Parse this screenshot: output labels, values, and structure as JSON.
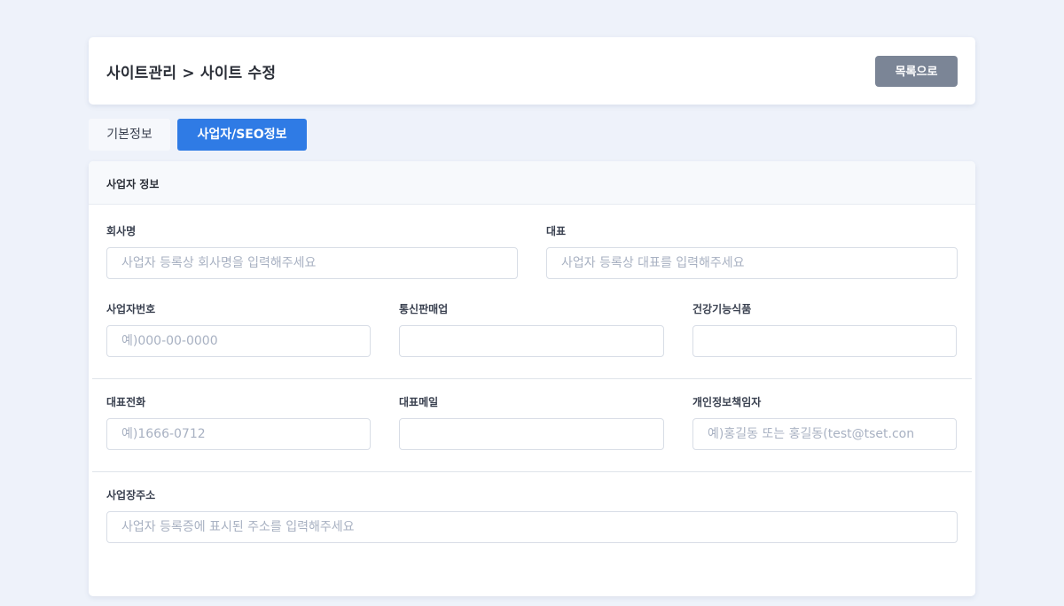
{
  "header": {
    "title": "사이트관리 > 사이트 수정",
    "back_button": "목록으로"
  },
  "tabs": [
    {
      "label": "기본정보",
      "active": false
    },
    {
      "label": "사업자/SEO정보",
      "active": true
    }
  ],
  "section": {
    "title": "사업자 정보"
  },
  "fields": {
    "company_name": {
      "label": "회사명",
      "value": "",
      "placeholder": "사업자 등록상 회사명을 입력해주세요"
    },
    "ceo": {
      "label": "대표",
      "value": "",
      "placeholder": "사업자 등록상 대표를 입력해주세요"
    },
    "business_number": {
      "label": "사업자번호",
      "value": "",
      "placeholder": "예)000-00-0000"
    },
    "mail_order_number": {
      "label": "통신판매업",
      "value": "",
      "placeholder": ""
    },
    "health_food": {
      "label": "건강기능식품",
      "value": "",
      "placeholder": ""
    },
    "phone": {
      "label": "대표전화",
      "value": "",
      "placeholder": "예)1666-0712"
    },
    "email": {
      "label": "대표메일",
      "value": "",
      "placeholder": ""
    },
    "privacy_officer": {
      "label": "개인정보책임자",
      "value": "",
      "placeholder": "예)홍길동 또는 홍길동(test@tset.con"
    },
    "address": {
      "label": "사업장주소",
      "value": "",
      "placeholder": "사업자 등록증에 표시된 주소를 입력해주세요"
    }
  },
  "colors": {
    "background": "#eef2fa",
    "primary": "#2f7be5",
    "back_button": "#7b8596"
  }
}
